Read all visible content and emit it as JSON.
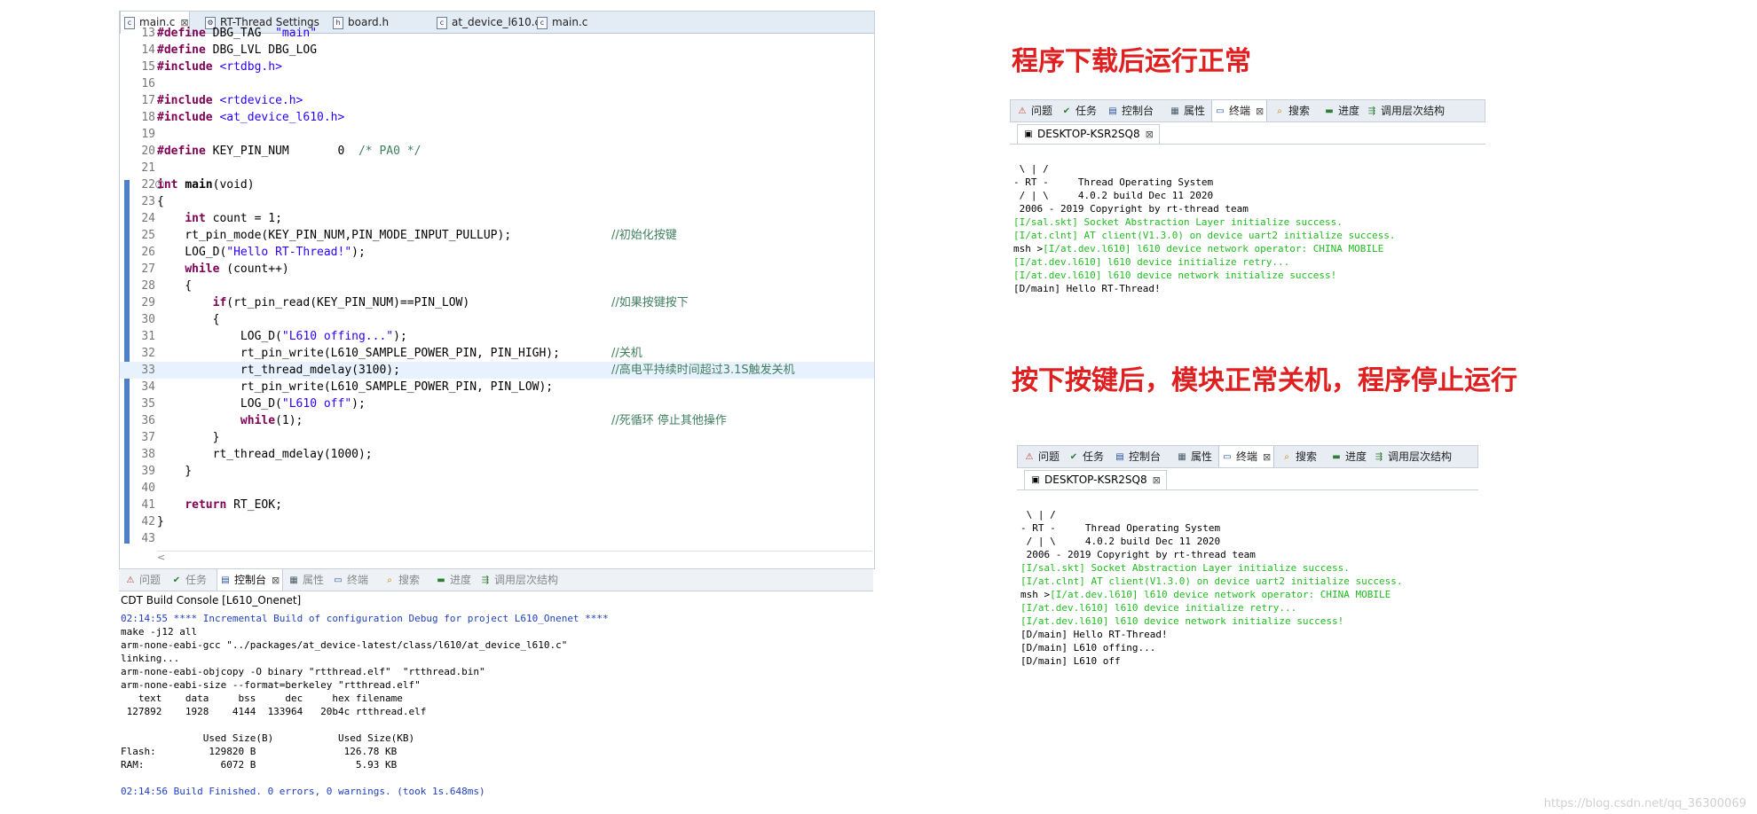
{
  "editor": {
    "tabs": [
      {
        "label": "main.c",
        "icon": "c-file-icon",
        "active": true
      },
      {
        "label": "RT-Thread Settings",
        "icon": "settings-icon"
      },
      {
        "label": "board.h",
        "icon": "h-file-icon"
      },
      {
        "label": "at_device_l610.c",
        "icon": "c-file-icon"
      },
      {
        "label": "main.c",
        "icon": "c-file-icon"
      }
    ],
    "lines": [
      {
        "n": "13",
        "code": "#define DBG_TAG  \"main\"",
        "comment": ""
      },
      {
        "n": "14",
        "code": "#define DBG_LVL DBG_LOG",
        "comment": ""
      },
      {
        "n": "15",
        "code": "#include <rtdbg.h>",
        "comment": ""
      },
      {
        "n": "16",
        "code": "",
        "comment": ""
      },
      {
        "n": "17",
        "code": "#include <rtdevice.h>",
        "comment": ""
      },
      {
        "n": "18",
        "code": "#include <at_device_l610.h>",
        "comment": ""
      },
      {
        "n": "19",
        "code": "",
        "comment": ""
      },
      {
        "n": "20",
        "code": "#define KEY_PIN_NUM       0  /* PA0 */",
        "comment": ""
      },
      {
        "n": "21",
        "code": "",
        "comment": ""
      },
      {
        "n": "22",
        "code": "int main(void)",
        "comment": ""
      },
      {
        "n": "23",
        "code": "{",
        "comment": ""
      },
      {
        "n": "24",
        "code": "    int count = 1;",
        "comment": ""
      },
      {
        "n": "25",
        "code": "    rt_pin_mode(KEY_PIN_NUM,PIN_MODE_INPUT_PULLUP);",
        "comment": "//初始化按键"
      },
      {
        "n": "26",
        "code": "    LOG_D(\"Hello RT-Thread!\");",
        "comment": ""
      },
      {
        "n": "27",
        "code": "    while (count++)",
        "comment": ""
      },
      {
        "n": "28",
        "code": "    {",
        "comment": ""
      },
      {
        "n": "29",
        "code": "        if(rt_pin_read(KEY_PIN_NUM)==PIN_LOW)",
        "comment": "//如果按键按下"
      },
      {
        "n": "30",
        "code": "        {",
        "comment": ""
      },
      {
        "n": "31",
        "code": "            LOG_D(\"L610 offing...\");",
        "comment": ""
      },
      {
        "n": "32",
        "code": "            rt_pin_write(L610_SAMPLE_POWER_PIN, PIN_HIGH);",
        "comment": "//关机"
      },
      {
        "n": "33",
        "code": "            rt_thread_mdelay(3100);",
        "comment": "//高电平持续时间超过3.1S触发关机"
      },
      {
        "n": "34",
        "code": "            rt_pin_write(L610_SAMPLE_POWER_PIN, PIN_LOW);",
        "comment": ""
      },
      {
        "n": "35",
        "code": "            LOG_D(\"L610 off\");",
        "comment": ""
      },
      {
        "n": "36",
        "code": "            while(1);",
        "comment": "//死循环 停止其他操作"
      },
      {
        "n": "37",
        "code": "        }",
        "comment": ""
      },
      {
        "n": "38",
        "code": "        rt_thread_mdelay(1000);",
        "comment": ""
      },
      {
        "n": "39",
        "code": "    }",
        "comment": ""
      },
      {
        "n": "40",
        "code": "",
        "comment": ""
      },
      {
        "n": "41",
        "code": "    return RT_EOK;",
        "comment": ""
      },
      {
        "n": "42",
        "code": "}",
        "comment": ""
      },
      {
        "n": "43",
        "code": "",
        "comment": ""
      }
    ],
    "scroll_left": "<"
  },
  "bottom_panel": {
    "tabs": [
      {
        "label": "问题",
        "icon": "problems-icon"
      },
      {
        "label": "任务",
        "icon": "tasks-icon"
      },
      {
        "label": "控制台",
        "icon": "console-icon",
        "active": true
      },
      {
        "label": "属性",
        "icon": "properties-icon"
      },
      {
        "label": "终端",
        "icon": "terminal-icon"
      },
      {
        "label": "搜索",
        "icon": "search-icon"
      },
      {
        "label": "进度",
        "icon": "progress-icon"
      },
      {
        "label": "调用层次结构",
        "icon": "call-hierarchy-icon"
      }
    ],
    "console_title": "CDT Build Console [L610_Onenet]",
    "lines": [
      {
        "text": "02:14:55 **** Incremental Build of configuration Debug for project L610_Onenet ****",
        "blue": true
      },
      {
        "text": "make -j12 all"
      },
      {
        "text": "arm-none-eabi-gcc \"../packages/at_device-latest/class/l610/at_device_l610.c\""
      },
      {
        "text": "linking..."
      },
      {
        "text": "arm-none-eabi-objcopy -O binary \"rtthread.elf\"  \"rtthread.bin\""
      },
      {
        "text": "arm-none-eabi-size --format=berkeley \"rtthread.elf\""
      },
      {
        "text": "   text    data     bss     dec     hex filename"
      },
      {
        "text": " 127892    1928    4144  133964   20b4c rtthread.elf"
      },
      {
        "text": ""
      },
      {
        "text": "              Used Size(B)           Used Size(KB)"
      },
      {
        "text": "Flash:         129820 B               126.78 KB"
      },
      {
        "text": "RAM:             6072 B                 5.93 KB"
      },
      {
        "text": ""
      },
      {
        "text": "02:14:56 Build Finished. 0 errors, 0 warnings. (took 1s.648ms)",
        "blue": true
      }
    ]
  },
  "panel_tabs": [
    {
      "label": "问题",
      "icon": "problems-icon"
    },
    {
      "label": "任务",
      "icon": "tasks-icon"
    },
    {
      "label": "控制台",
      "icon": "console-icon"
    },
    {
      "label": "属性",
      "icon": "properties-icon"
    },
    {
      "label": "终端",
      "icon": "terminal-icon",
      "active": true
    },
    {
      "label": "搜索",
      "icon": "search-icon"
    },
    {
      "label": "进度",
      "icon": "progress-icon"
    },
    {
      "label": "调用层次结构",
      "icon": "call-hierarchy-icon"
    }
  ],
  "terminal1": {
    "heading": "程序下载后运行正常",
    "session_tab": "DESKTOP-KSR2SQ8",
    "lines": [
      {
        "text": ""
      },
      {
        "text": " \\ | /"
      },
      {
        "text": "- RT -     Thread Operating System"
      },
      {
        "text": " / | \\     4.0.2 build Dec 11 2020"
      },
      {
        "text": " 2006 - 2019 Copyright by rt-thread team"
      },
      {
        "text": "[I/sal.skt] Socket Abstraction Layer initialize success.",
        "green": true
      },
      {
        "text": "[I/at.clnt] AT client(V1.3.0) on device uart2 initialize success.",
        "green": true
      },
      {
        "text": "msh >[I/at.dev.l610] l610 device network operator: CHINA MOBILE",
        "green_after": "msh >"
      },
      {
        "text": "[I/at.dev.l610] l610 device initialize retry...",
        "green": true
      },
      {
        "text": "[I/at.dev.l610] l610 device network initialize success!",
        "green": true
      },
      {
        "text": "[D/main] Hello RT-Thread!"
      }
    ]
  },
  "terminal2": {
    "heading": "按下按键后，模块正常关机，程序停止运行",
    "session_tab": "DESKTOP-KSR2SQ8",
    "lines": [
      {
        "text": ""
      },
      {
        "text": " \\ | /"
      },
      {
        "text": "- RT -     Thread Operating System"
      },
      {
        "text": " / | \\     4.0.2 build Dec 11 2020"
      },
      {
        "text": " 2006 - 2019 Copyright by rt-thread team"
      },
      {
        "text": "[I/sal.skt] Socket Abstraction Layer initialize success.",
        "green": true
      },
      {
        "text": "[I/at.clnt] AT client(V1.3.0) on device uart2 initialize success.",
        "green": true
      },
      {
        "text": "msh >[I/at.dev.l610] l610 device network operator: CHINA MOBILE",
        "green_after": "msh >"
      },
      {
        "text": "[I/at.dev.l610] l610 device initialize retry...",
        "green": true
      },
      {
        "text": "[I/at.dev.l610] l610 device network initialize success!",
        "green": true
      },
      {
        "text": "[D/main] Hello RT-Thread!"
      },
      {
        "text": "[D/main] L610 offing..."
      },
      {
        "text": "[D/main] L610 off"
      }
    ]
  },
  "watermark": "https://blog.csdn.net/qq_36300069",
  "colors": {
    "heading": "#e02020",
    "green": "#22bb22",
    "comment": "#3f7f5f",
    "keyword": "#7f0055",
    "string": "#2a00ff",
    "console_blue": "#1f3fbf"
  }
}
